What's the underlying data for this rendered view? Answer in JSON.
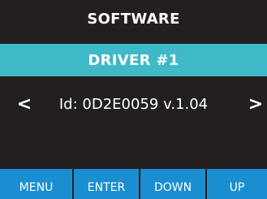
{
  "header": {
    "title": "SOFTWARE"
  },
  "section": {
    "title": "DRIVER #1"
  },
  "value": {
    "text": "Id: 0D2E0059 v.1.04"
  },
  "nav": {
    "prev_glyph": "<",
    "next_glyph": ">"
  },
  "footer": {
    "menu_label": "MENU",
    "enter_label": "ENTER",
    "down_label": "DOWN",
    "up_label": "UP"
  },
  "colors": {
    "background": "#231f20",
    "section_bar": "#3fb8c8",
    "softkey": "#1a8ed0",
    "text": "#ffffff"
  }
}
